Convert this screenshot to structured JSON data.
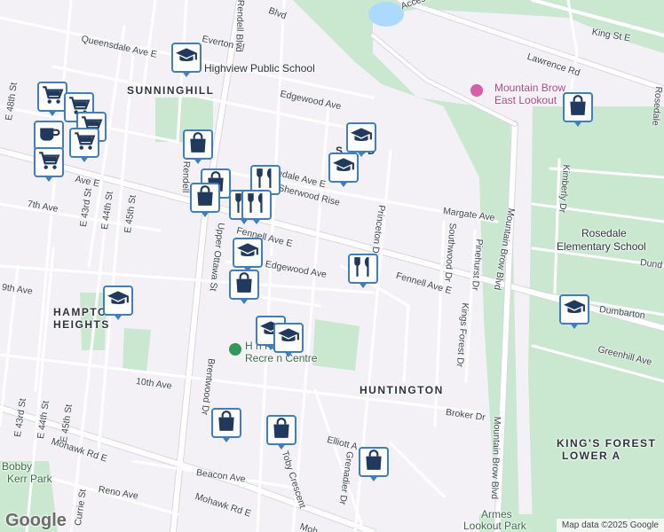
{
  "map": {
    "neighborhoods": {
      "sunninghill": "SUNNINGHILL",
      "huntington": "HUNTINGTON",
      "hampton_line1": "HAMPTON",
      "hampton_line2": "HEIGHTS",
      "kings_forest_line1": "KING'S FOREST",
      "kings_forest_line2": "LOWER A",
      "sherwood_partial": "S        OOD"
    },
    "pois": {
      "highview_school": "Highview Public School",
      "lookout_line1": "Mountain Brow",
      "lookout_line2": "East Lookout",
      "rosedale_line1": "Rosedale",
      "rosedale_line2": "Elementary School",
      "rec_line1": "H                n Park",
      "rec_line2": "Recre        n Centre",
      "bobby_line1": "Bobby",
      "bobby_line2": "Kerr Park",
      "armes_line1": "Armes",
      "armes_line2": "Lookout Park"
    },
    "streets": {
      "everton": "Everton Pl",
      "rendell_blvd_top": "Rendell Blvd",
      "queensdale": "Queensdale Ave E",
      "king_st": "King St E",
      "lawrence": "Lawrence Rd",
      "access": "Access",
      "edgewood": "Edgewood Ave",
      "brucedale": "Brucedale Ave E",
      "sherwood_rise": "Sherwood Rise",
      "margate": "Margate Ave",
      "princeton": "Princeton Dr",
      "fennell_w": "Fennell Ave E",
      "fennell_e": "Fennell Ave E",
      "upper_ottawa": "Upper Ottawa St",
      "rendell_mid": "Rendell",
      "brentwood": "Brentwood Dr",
      "tenth": "10th Ave",
      "ninth": "9th Ave",
      "seventh": "7th Ave",
      "e43": "E 43rd St",
      "e44": "E 44th St",
      "e45": "E 45th St",
      "e48": "E 48th St",
      "e43b": "E 43rd St",
      "e44b": "E 44th St",
      "e45b": "E 45th St",
      "ave_e_left": "Ave E",
      "mohawk1": "Mohawk Rd E",
      "mohawk2": "Mohawk Rd E",
      "beacon": "Beacon Ave",
      "reno": "Reno Ave",
      "currie": "Currie St",
      "toby": "Toby Crescent",
      "grenadier": "Grenadier Dr",
      "elliott": "Elliott A",
      "broker": "Broker Dr",
      "southwood": "Southwood Dr",
      "pinehurst": "Pinehurst Dr",
      "kings_forest_dr": "Kings Forest Dr",
      "mountain_brow_n": "Mountain Brow Blvd",
      "mountain_brow_s": "Mountain Brow Blvd",
      "kimberly": "Kimberly Dr",
      "dumbarton": "Dumbarton",
      "greenhill": "Greenhill Ave",
      "rosedale_ave": "Rosedale",
      "dund": "Dund",
      "edgewood_s": "Edgewood Ave",
      "blvd_top": "Blvd",
      "ave_e_top": "ale Ave E",
      "mohawk_tail": "Moh"
    },
    "attribution": "Map data ©2025 Google",
    "logo": "Google",
    "colors": {
      "pin_border": "#3e7fc4",
      "pin_icon": "#1f3a5c",
      "park": "#c9e8cf",
      "water": "#aadaff",
      "background": "#f3f1f5"
    },
    "markers": [
      {
        "icon": "school-icon"
      },
      {
        "icon": "cart-icon"
      },
      {
        "icon": "cart-icon"
      },
      {
        "icon": "cart-icon"
      },
      {
        "icon": "cafe-icon"
      },
      {
        "icon": "cart-icon"
      },
      {
        "icon": "cart-icon"
      },
      {
        "icon": "shopping-bag-icon"
      },
      {
        "icon": "shopping-bag-icon"
      },
      {
        "icon": "shopping-bag-icon"
      },
      {
        "icon": "restaurant-icon"
      },
      {
        "icon": "restaurant-icon"
      },
      {
        "icon": "restaurant-icon"
      },
      {
        "icon": "school-icon"
      },
      {
        "icon": "school-icon"
      },
      {
        "icon": "school-icon"
      },
      {
        "icon": "shopping-bag-icon"
      },
      {
        "icon": "school-icon"
      },
      {
        "icon": "restaurant-icon"
      },
      {
        "icon": "school-icon"
      },
      {
        "icon": "school-icon"
      },
      {
        "icon": "shopping-bag-icon"
      },
      {
        "icon": "shopping-bag-icon"
      },
      {
        "icon": "shopping-bag-icon"
      },
      {
        "icon": "shopping-bag-icon"
      },
      {
        "icon": "school-icon"
      }
    ]
  }
}
